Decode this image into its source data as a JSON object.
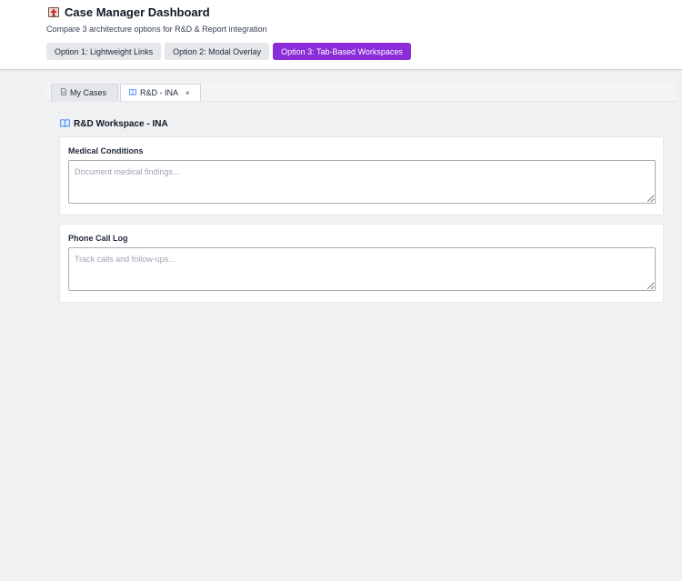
{
  "header": {
    "title": "Case Manager Dashboard",
    "subtitle": "Compare 3 architecture options for R&D & Report integration",
    "app_icon": "hospital-icon",
    "options": [
      {
        "label": "Option 1: Lightweight Links",
        "active": false
      },
      {
        "label": "Option 2: Modal Overlay",
        "active": false
      },
      {
        "label": "Option 3: Tab-Based Workspaces",
        "active": true
      }
    ],
    "accent_color": "#8b2bd9"
  },
  "tabs": [
    {
      "label": "My Cases",
      "icon": "document-icon",
      "closable": false,
      "active": false
    },
    {
      "label": "R&D - INA",
      "icon": "book-icon",
      "closable": true,
      "close_glyph": "×",
      "active": true
    }
  ],
  "workspace": {
    "icon": "book-icon",
    "title": "R&D Workspace - INA",
    "fields": [
      {
        "label": "Medical Conditions",
        "value": "",
        "placeholder": "Document medical findings..."
      },
      {
        "label": "Phone Call Log",
        "value": "",
        "placeholder": "Track calls and follow-ups..."
      }
    ]
  }
}
